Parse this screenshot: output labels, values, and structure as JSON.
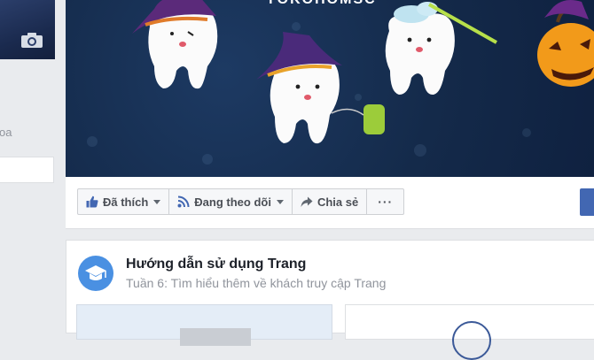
{
  "cover": {
    "title": "YOKOHOMSC"
  },
  "sidebar": {
    "partial_text": "oa"
  },
  "actions": {
    "like_label": "Đã thích",
    "follow_label": "Đang theo dõi",
    "share_label": "Chia sẻ",
    "more_label": "···"
  },
  "guide": {
    "title": "Hướng dẫn sử dụng Trang",
    "subtitle": "Tuần 6: Tìm hiểu thêm về khách truy cập Trang"
  },
  "icons": {
    "like": "thumbs-up-icon",
    "follow": "rss-icon",
    "share": "share-arrow-icon",
    "camera": "camera-icon",
    "guide": "graduation-cap-icon"
  },
  "colors": {
    "brand_blue": "#4267b2",
    "cover_bg": "#142a4a",
    "guide_icon_bg": "#4a90e2"
  }
}
